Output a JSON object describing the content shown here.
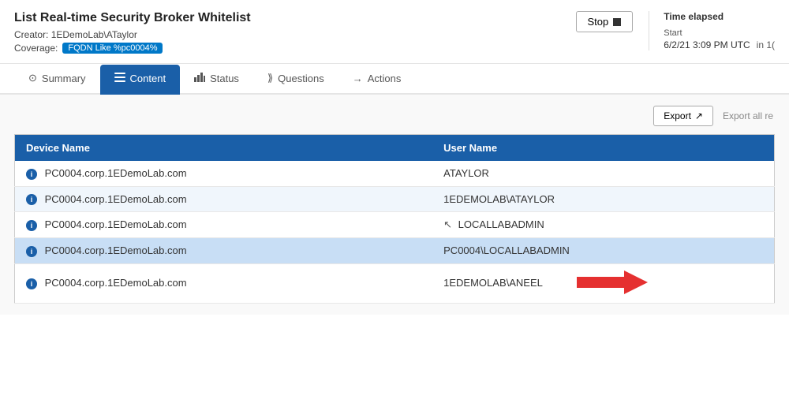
{
  "page": {
    "title": "List Real-time Security Broker Whitelist",
    "creator_label": "Creator:",
    "creator_value": "1EDemoLab\\ATaylor",
    "coverage_label": "Coverage:",
    "coverage_badge": "FQDN Like %pc0004%",
    "stop_button_label": "Stop",
    "time_elapsed_label": "Time elapsed",
    "start_label": "Start",
    "start_value": "6/2/21 3:09 PM UTC",
    "in_text": "in 1("
  },
  "tabs": [
    {
      "id": "summary",
      "label": "Summary",
      "icon": "⊙",
      "active": false
    },
    {
      "id": "content",
      "label": "Content",
      "icon": "☰",
      "active": true
    },
    {
      "id": "status",
      "label": "Status",
      "icon": "📊",
      "active": false
    },
    {
      "id": "questions",
      "label": "Questions",
      "icon": "⟫",
      "active": false
    },
    {
      "id": "actions",
      "label": "Actions",
      "icon": "→",
      "active": false
    }
  ],
  "toolbar": {
    "export_label": "Export",
    "export_icon": "↗",
    "export_all_label": "Export all re"
  },
  "table": {
    "headers": [
      {
        "id": "device_name",
        "label": "Device Name"
      },
      {
        "id": "user_name",
        "label": "User Name"
      }
    ],
    "rows": [
      {
        "device": "PC0004.corp.1EDemoLab.com",
        "user": "ATAYLOR"
      },
      {
        "device": "PC0004.corp.1EDemoLab.com",
        "user": "1EDEMOLAB\\ATAYLOR"
      },
      {
        "device": "PC0004.corp.1EDemoLab.com",
        "user": "LOCALLABADMIN"
      },
      {
        "device": "PC0004.corp.1EDemoLab.com",
        "user": "PC0004\\LOCALLABADMIN"
      },
      {
        "device": "PC0004.corp.1EDemoLab.com",
        "user": "1EDEMOLAB\\ANEEL"
      }
    ]
  },
  "colors": {
    "header_bg": "#1a5fa8",
    "accent_blue": "#0078c8",
    "red_arrow": "#e53030",
    "tab_active_bg": "#1a5fa8"
  }
}
